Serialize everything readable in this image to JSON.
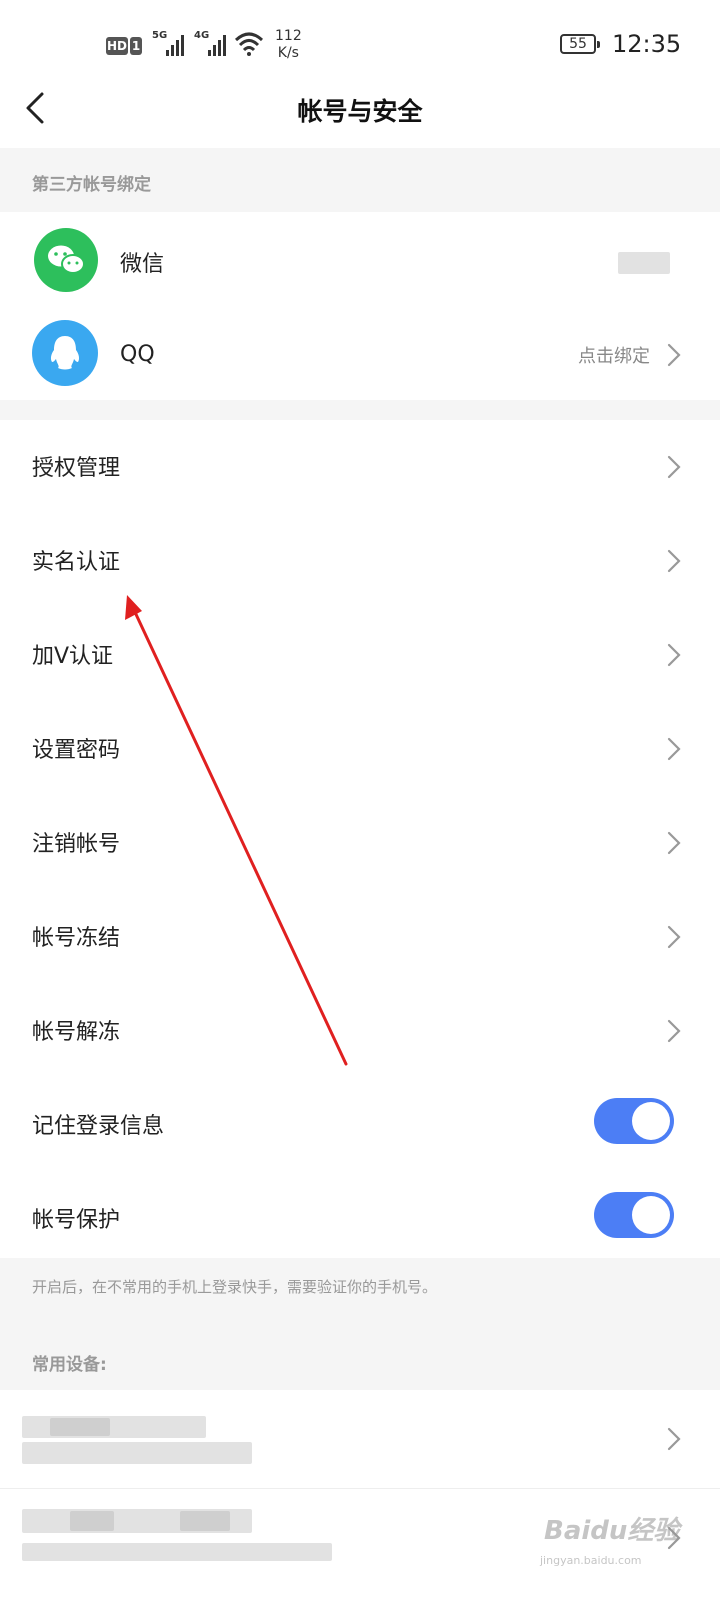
{
  "status_bar": {
    "hd": "HD",
    "sim": "1",
    "net1": "5G",
    "net2": "4G",
    "speed_value": "112",
    "speed_unit": "K/s",
    "battery": "55",
    "time": "12:35"
  },
  "header": {
    "title": "帐号与安全",
    "back_icon": "chevron-left-icon"
  },
  "third_party": {
    "section_label": "第三方帐号绑定",
    "items": [
      {
        "label": "微信",
        "icon": "wechat-icon",
        "color": "#2dbf5c"
      },
      {
        "label": "QQ",
        "icon": "qq-penguin-icon",
        "color": "#3aa8f0",
        "value": "点击绑定"
      }
    ]
  },
  "settings": {
    "items": [
      {
        "label": "授权管理"
      },
      {
        "label": "实名认证"
      },
      {
        "label": "加V认证"
      },
      {
        "label": "设置密码"
      },
      {
        "label": "注销帐号"
      },
      {
        "label": "帐号冻结"
      },
      {
        "label": "帐号解冻"
      }
    ],
    "toggles": [
      {
        "label": "记住登录信息",
        "on": true
      },
      {
        "label": "帐号保护",
        "on": true
      }
    ],
    "toggle_color": "#4c7ef5",
    "note": "开启后，在不常用的手机上登录快手，需要验证你的手机号。"
  },
  "devices": {
    "section_label": "常用设备:"
  },
  "annotation": {
    "arrow_color": "#e02020"
  },
  "watermark": {
    "main": "Baidu经验",
    "sub": "jingyan.baidu.com"
  }
}
